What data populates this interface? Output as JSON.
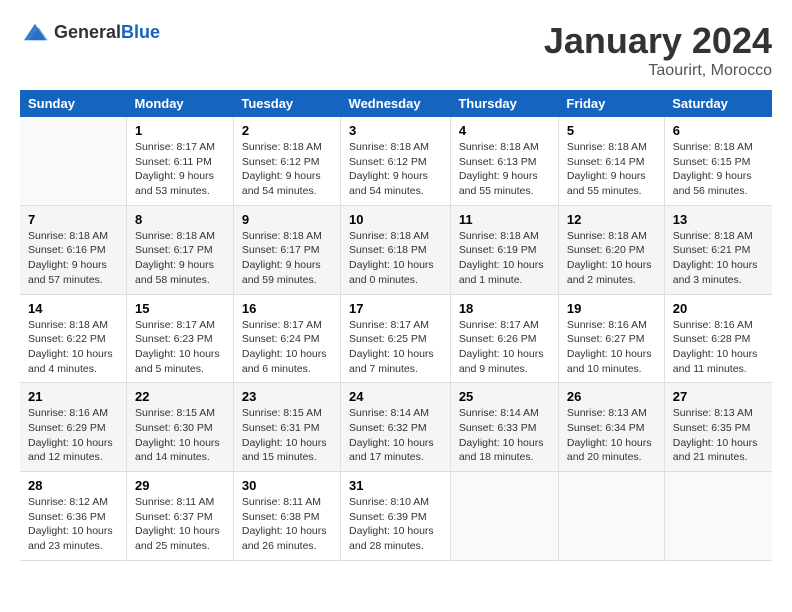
{
  "header": {
    "logo_general": "General",
    "logo_blue": "Blue",
    "month_title": "January 2024",
    "location": "Taourirt, Morocco"
  },
  "days_of_week": [
    "Sunday",
    "Monday",
    "Tuesday",
    "Wednesday",
    "Thursday",
    "Friday",
    "Saturday"
  ],
  "weeks": [
    [
      {
        "day": "",
        "sunrise": "",
        "sunset": "",
        "daylight": ""
      },
      {
        "day": "1",
        "sunrise": "Sunrise: 8:17 AM",
        "sunset": "Sunset: 6:11 PM",
        "daylight": "Daylight: 9 hours and 53 minutes."
      },
      {
        "day": "2",
        "sunrise": "Sunrise: 8:18 AM",
        "sunset": "Sunset: 6:12 PM",
        "daylight": "Daylight: 9 hours and 54 minutes."
      },
      {
        "day": "3",
        "sunrise": "Sunrise: 8:18 AM",
        "sunset": "Sunset: 6:12 PM",
        "daylight": "Daylight: 9 hours and 54 minutes."
      },
      {
        "day": "4",
        "sunrise": "Sunrise: 8:18 AM",
        "sunset": "Sunset: 6:13 PM",
        "daylight": "Daylight: 9 hours and 55 minutes."
      },
      {
        "day": "5",
        "sunrise": "Sunrise: 8:18 AM",
        "sunset": "Sunset: 6:14 PM",
        "daylight": "Daylight: 9 hours and 55 minutes."
      },
      {
        "day": "6",
        "sunrise": "Sunrise: 8:18 AM",
        "sunset": "Sunset: 6:15 PM",
        "daylight": "Daylight: 9 hours and 56 minutes."
      }
    ],
    [
      {
        "day": "7",
        "sunrise": "Sunrise: 8:18 AM",
        "sunset": "Sunset: 6:16 PM",
        "daylight": "Daylight: 9 hours and 57 minutes."
      },
      {
        "day": "8",
        "sunrise": "Sunrise: 8:18 AM",
        "sunset": "Sunset: 6:17 PM",
        "daylight": "Daylight: 9 hours and 58 minutes."
      },
      {
        "day": "9",
        "sunrise": "Sunrise: 8:18 AM",
        "sunset": "Sunset: 6:17 PM",
        "daylight": "Daylight: 9 hours and 59 minutes."
      },
      {
        "day": "10",
        "sunrise": "Sunrise: 8:18 AM",
        "sunset": "Sunset: 6:18 PM",
        "daylight": "Daylight: 10 hours and 0 minutes."
      },
      {
        "day": "11",
        "sunrise": "Sunrise: 8:18 AM",
        "sunset": "Sunset: 6:19 PM",
        "daylight": "Daylight: 10 hours and 1 minute."
      },
      {
        "day": "12",
        "sunrise": "Sunrise: 8:18 AM",
        "sunset": "Sunset: 6:20 PM",
        "daylight": "Daylight: 10 hours and 2 minutes."
      },
      {
        "day": "13",
        "sunrise": "Sunrise: 8:18 AM",
        "sunset": "Sunset: 6:21 PM",
        "daylight": "Daylight: 10 hours and 3 minutes."
      }
    ],
    [
      {
        "day": "14",
        "sunrise": "Sunrise: 8:18 AM",
        "sunset": "Sunset: 6:22 PM",
        "daylight": "Daylight: 10 hours and 4 minutes."
      },
      {
        "day": "15",
        "sunrise": "Sunrise: 8:17 AM",
        "sunset": "Sunset: 6:23 PM",
        "daylight": "Daylight: 10 hours and 5 minutes."
      },
      {
        "day": "16",
        "sunrise": "Sunrise: 8:17 AM",
        "sunset": "Sunset: 6:24 PM",
        "daylight": "Daylight: 10 hours and 6 minutes."
      },
      {
        "day": "17",
        "sunrise": "Sunrise: 8:17 AM",
        "sunset": "Sunset: 6:25 PM",
        "daylight": "Daylight: 10 hours and 7 minutes."
      },
      {
        "day": "18",
        "sunrise": "Sunrise: 8:17 AM",
        "sunset": "Sunset: 6:26 PM",
        "daylight": "Daylight: 10 hours and 9 minutes."
      },
      {
        "day": "19",
        "sunrise": "Sunrise: 8:16 AM",
        "sunset": "Sunset: 6:27 PM",
        "daylight": "Daylight: 10 hours and 10 minutes."
      },
      {
        "day": "20",
        "sunrise": "Sunrise: 8:16 AM",
        "sunset": "Sunset: 6:28 PM",
        "daylight": "Daylight: 10 hours and 11 minutes."
      }
    ],
    [
      {
        "day": "21",
        "sunrise": "Sunrise: 8:16 AM",
        "sunset": "Sunset: 6:29 PM",
        "daylight": "Daylight: 10 hours and 12 minutes."
      },
      {
        "day": "22",
        "sunrise": "Sunrise: 8:15 AM",
        "sunset": "Sunset: 6:30 PM",
        "daylight": "Daylight: 10 hours and 14 minutes."
      },
      {
        "day": "23",
        "sunrise": "Sunrise: 8:15 AM",
        "sunset": "Sunset: 6:31 PM",
        "daylight": "Daylight: 10 hours and 15 minutes."
      },
      {
        "day": "24",
        "sunrise": "Sunrise: 8:14 AM",
        "sunset": "Sunset: 6:32 PM",
        "daylight": "Daylight: 10 hours and 17 minutes."
      },
      {
        "day": "25",
        "sunrise": "Sunrise: 8:14 AM",
        "sunset": "Sunset: 6:33 PM",
        "daylight": "Daylight: 10 hours and 18 minutes."
      },
      {
        "day": "26",
        "sunrise": "Sunrise: 8:13 AM",
        "sunset": "Sunset: 6:34 PM",
        "daylight": "Daylight: 10 hours and 20 minutes."
      },
      {
        "day": "27",
        "sunrise": "Sunrise: 8:13 AM",
        "sunset": "Sunset: 6:35 PM",
        "daylight": "Daylight: 10 hours and 21 minutes."
      }
    ],
    [
      {
        "day": "28",
        "sunrise": "Sunrise: 8:12 AM",
        "sunset": "Sunset: 6:36 PM",
        "daylight": "Daylight: 10 hours and 23 minutes."
      },
      {
        "day": "29",
        "sunrise": "Sunrise: 8:11 AM",
        "sunset": "Sunset: 6:37 PM",
        "daylight": "Daylight: 10 hours and 25 minutes."
      },
      {
        "day": "30",
        "sunrise": "Sunrise: 8:11 AM",
        "sunset": "Sunset: 6:38 PM",
        "daylight": "Daylight: 10 hours and 26 minutes."
      },
      {
        "day": "31",
        "sunrise": "Sunrise: 8:10 AM",
        "sunset": "Sunset: 6:39 PM",
        "daylight": "Daylight: 10 hours and 28 minutes."
      },
      {
        "day": "",
        "sunrise": "",
        "sunset": "",
        "daylight": ""
      },
      {
        "day": "",
        "sunrise": "",
        "sunset": "",
        "daylight": ""
      },
      {
        "day": "",
        "sunrise": "",
        "sunset": "",
        "daylight": ""
      }
    ]
  ]
}
